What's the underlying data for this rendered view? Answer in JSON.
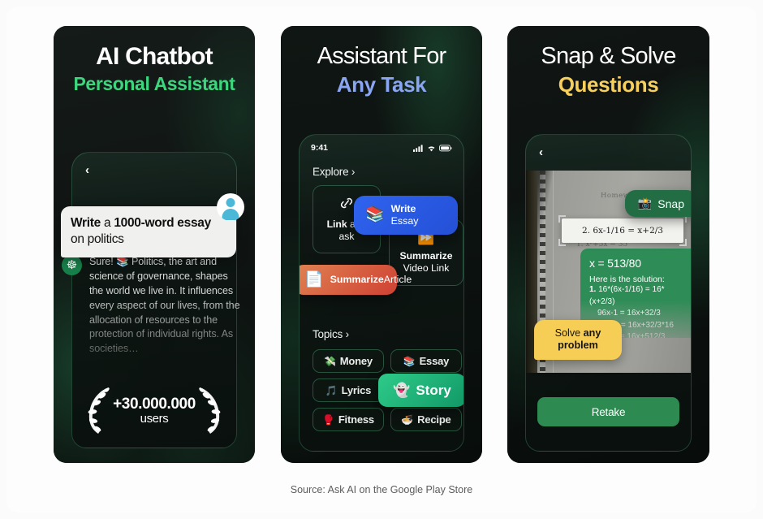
{
  "footer": {
    "source": "Source: Ask AI on the Google Play Store"
  },
  "colors": {
    "page_background": "#fbfbfb",
    "panel_background": "#10161350",
    "accent_green": "#3dd67f",
    "accent_blue": "#8aa6f2",
    "accent_yellow": "#f6cf5c",
    "brand_green": "#2d8b52",
    "snap_green": "#236d45",
    "write_blue": "#2450d6",
    "summarize_orange": "#cf4133",
    "story_green": "#129967",
    "solve_yellow": "#f7ce55"
  },
  "panels": [
    {
      "id": "ai-chatbot",
      "headline": "AI Chatbot",
      "subheadline": "Personal Assistant",
      "back_icon": "chevron-left-icon",
      "user_bubble": {
        "avatar_icon": "user-avatar-icon",
        "text_parts": [
          {
            "text": "Write ",
            "bold": true
          },
          {
            "text": "a ",
            "bold": false
          },
          {
            "text": "1000-word ",
            "bold": true
          },
          {
            "text": "essay ",
            "bold": true
          },
          {
            "text": "on politics",
            "bold": false
          }
        ],
        "plain": "Write a 1000-word essay on politics"
      },
      "ai_reply": {
        "logo_icon": "ask-ai-logo-icon",
        "text": "Sure! 📚 Politics, the art and science of governance, shapes the world we live in. It influences every aspect of our lives, from the allocation of resources to the protection of individual rights. As societies…"
      },
      "badge": {
        "icon": "laurel-wreath-icon",
        "number": "+30.000.000",
        "label": "users"
      }
    },
    {
      "id": "assistant-any-task",
      "headline": "Assistant For",
      "subheadline": "Any Task",
      "status_bar": {
        "time": "9:41",
        "icons": [
          "cellular-signal-icon",
          "wifi-icon",
          "battery-icon"
        ]
      },
      "sections": [
        {
          "label": "Explore ›"
        },
        {
          "label": "Topics ›"
        }
      ],
      "cards": [
        {
          "name": "link-and-ask",
          "icon": "link-icon",
          "title": "Link",
          "subtitle": " and ask",
          "style": "outline"
        },
        {
          "name": "write-essay",
          "icon": "📚",
          "title": "Write",
          "subtitle": "Essay",
          "style": "blue"
        },
        {
          "name": "summarize-article",
          "icon": "📄",
          "title": "Summarize",
          "subtitle": "Article",
          "style": "orange"
        },
        {
          "name": "summarize-video-link",
          "icon": "⏩",
          "title": "Summarize",
          "subtitle": "Video Link",
          "style": "outline"
        }
      ],
      "chips": [
        {
          "name": "money",
          "icon": "💸",
          "label": "Money",
          "active": false
        },
        {
          "name": "essay",
          "icon": "📚",
          "label": "Essay",
          "active": false
        },
        {
          "name": "lyrics",
          "icon": "🎵",
          "label": "Lyrics",
          "active": false
        },
        {
          "name": "story",
          "icon": "👻",
          "label": "Story",
          "active": true
        },
        {
          "name": "fitness",
          "icon": "🥊",
          "label": "Fitness",
          "active": false
        },
        {
          "name": "recipe",
          "icon": "🍜",
          "label": "Recipe",
          "active": false
        }
      ]
    },
    {
      "id": "snap-and-solve",
      "headline": "Snap & Solve",
      "subheadline": "Questions",
      "back_icon": "chevron-left-icon",
      "notebook": {
        "title": "Homework",
        "line_1": "1. x²+5x = 35",
        "cropped_equation": "2. 6x-1/16 = x+2/3"
      },
      "snap_badge": {
        "icon": "📸",
        "label": "Snap"
      },
      "solution": {
        "answer": "x = 513/80",
        "lead": "Here is the solution:",
        "steps": [
          {
            "num": "1.",
            "text": "16*(6x-1/16) = 16*(x+2/3)"
          },
          {
            "num": "",
            "text": "96x-1 = 16x+32/3"
          },
          {
            "num": "2.",
            "text": "96x-1 = 16x+32/3*16"
          },
          {
            "num": "",
            "text": "96x-1  = 16x+512/3"
          }
        ]
      },
      "solve_badge": {
        "prefix": "Solve ",
        "bold": "any",
        "suffix": "problem"
      },
      "retake_label": "Retake"
    }
  ]
}
